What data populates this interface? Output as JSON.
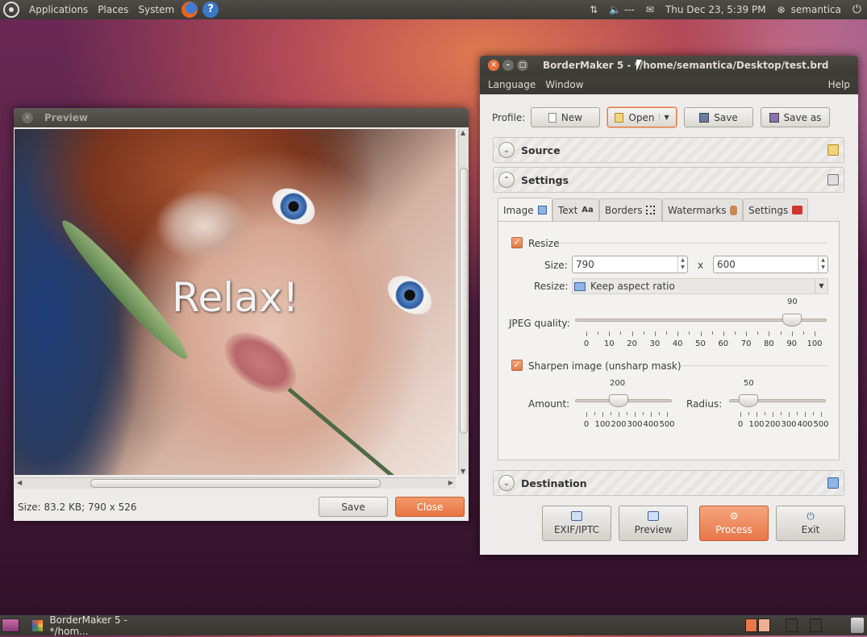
{
  "top_panel": {
    "menus": [
      "Applications",
      "Places",
      "System"
    ],
    "tray": {
      "network": "⇅",
      "volume": "🔈 ---",
      "mail": "✉",
      "clock": "Thu Dec 23,  5:39 PM",
      "user": "semantica",
      "power": "⏻"
    }
  },
  "preview_window": {
    "title": "Preview",
    "overlay_text": "Relax!",
    "status": "Size: 83.2 KB; 790 x 526",
    "save_label": "Save",
    "close_label": "Close"
  },
  "main_window": {
    "title": "BorderMaker 5 - */home/semantica/Desktop/test.brd",
    "menu": {
      "language": "Language",
      "window": "Window",
      "help": "Help"
    },
    "profile_label": "Profile:",
    "profile_buttons": {
      "new": "New",
      "open": "Open",
      "save": "Save",
      "save_as": "Save as"
    },
    "sections": {
      "source": "Source",
      "settings": "Settings",
      "destination": "Destination"
    },
    "tabs": {
      "image": "Image",
      "text": "Text",
      "text_icon": "Aa",
      "borders": "Borders",
      "watermarks": "Watermarks",
      "settings": "Settings"
    },
    "image_tab": {
      "resize_checkbox": "Resize",
      "size_label": "Size:",
      "width": "790",
      "times": "x",
      "height": "600",
      "resize_mode_label": "Resize:",
      "resize_mode_value": "Keep aspect ratio",
      "jpeg_label": "JPEG quality:",
      "jpeg_value": 90,
      "jpeg_value_text": "90",
      "jpeg_ticks": [
        "0",
        "10",
        "20",
        "30",
        "40",
        "50",
        "60",
        "70",
        "80",
        "90",
        "100"
      ],
      "sharpen_checkbox": "Sharpen image (unsharp mask)",
      "amount_label": "Amount:",
      "amount_value": 200,
      "amount_value_text": "200",
      "amount_ticks": [
        "0",
        "100",
        "200",
        "300",
        "400",
        "500"
      ],
      "radius_label": "Radius:",
      "radius_value": 50,
      "radius_value_text": "50",
      "radius_ticks": [
        "0",
        "100",
        "200",
        "300",
        "400",
        "500"
      ]
    },
    "bottom_buttons": {
      "exif": "EXIF/IPTC",
      "preview": "Preview",
      "process": "Process",
      "exit": "Exit"
    }
  },
  "bottom_panel": {
    "task_label": "BorderMaker 5 - */hom..."
  }
}
